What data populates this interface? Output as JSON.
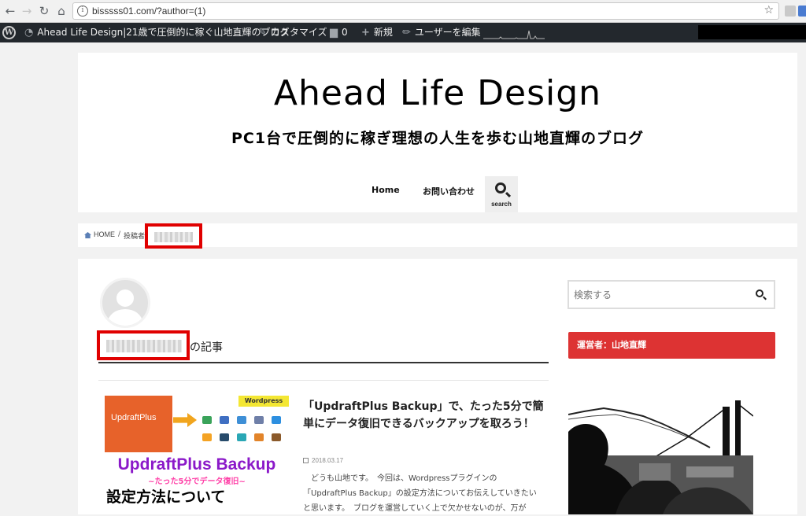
{
  "browser": {
    "url": "bisssss01.com/?author=(1)",
    "back_icon": "←",
    "forward_icon": "→",
    "reload_icon": "↻",
    "home_icon": "⌂",
    "info_icon": "i",
    "star_icon": "☆"
  },
  "admin_bar": {
    "wp_logo": "W",
    "site_name": "Ahead Life Design|21歳で圧倒的に稼ぐ山地直輝のブログ",
    "customize": "カスタマイズ",
    "comments_count": "0",
    "new": "新規",
    "edit_user": "ユーザーを編集"
  },
  "header": {
    "title": "Ahead Life Design",
    "tagline": "PC1台で圧倒的に稼ぎ理想の人生を歩む山地直輝のブログ",
    "menu": {
      "home": "Home",
      "contact": "お問い合わせ",
      "search": "search"
    }
  },
  "breadcrumb": {
    "home": "HOME",
    "separator": "/",
    "author_prefix": "投稿者"
  },
  "archive": {
    "suffix": "の記事"
  },
  "post": {
    "thumbnail": {
      "logo": "UpdraftPlus",
      "badge": "Wordpress",
      "line1": "UpdraftPlus Backup",
      "line2": "~たった5分でデータ復旧~",
      "line3": "設定方法について"
    },
    "title": "「UpdraftPlus Backup」で、たった5分で簡単にデータ復旧できるバックアップを取ろう！",
    "date": "2018.03.17",
    "excerpt": "　どうも山地です。　今回は、Wordpressプラグインの「UpdraftPlus Backup」の設定方法についてお伝えしていきたいと思います。　ブログを運営していく上で欠かせないのが、万が"
  },
  "sidebar": {
    "search_placeholder": "検索する",
    "widget_title": "運営者：山地直輝"
  },
  "colors": {
    "accent_red": "#dd3333",
    "redaction": "#e00000",
    "admin_bar": "#23282d"
  }
}
